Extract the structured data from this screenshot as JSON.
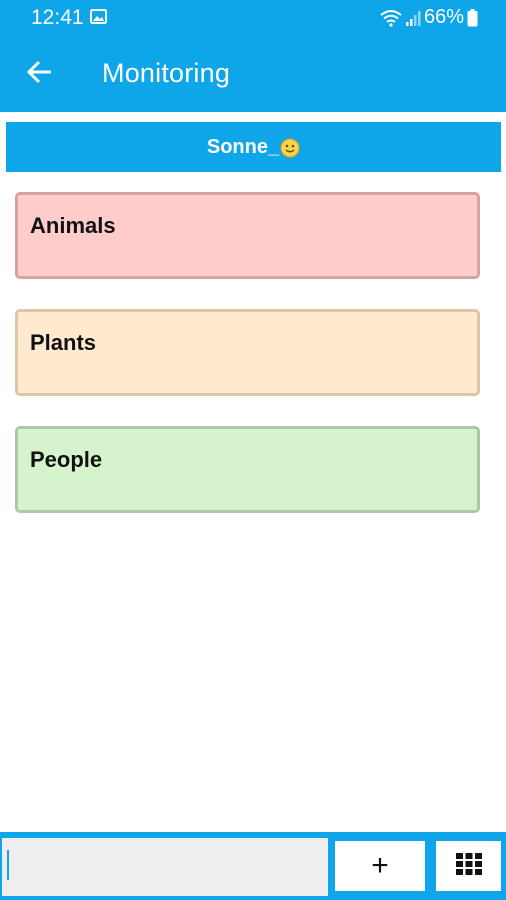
{
  "status_bar": {
    "time": "12:41",
    "battery": "66%",
    "icons": [
      "gallery-icon",
      "wifi-icon",
      "signal-icon",
      "battery-icon"
    ]
  },
  "app_bar": {
    "title": "Monitoring",
    "back_icon": "arrow-left-icon"
  },
  "user_banner": {
    "name": "Sonne_",
    "emoji": "smiley-icon"
  },
  "categories": [
    {
      "label": "Animals",
      "color": "#ffcccc"
    },
    {
      "label": "Plants",
      "color": "#ffe9cf"
    },
    {
      "label": "People",
      "color": "#d5f3cd"
    }
  ],
  "bottom_bar": {
    "input_value": "",
    "add_label": "+",
    "grid_icon": "grid-icon"
  },
  "colors": {
    "accent": "#0ea5e9"
  }
}
